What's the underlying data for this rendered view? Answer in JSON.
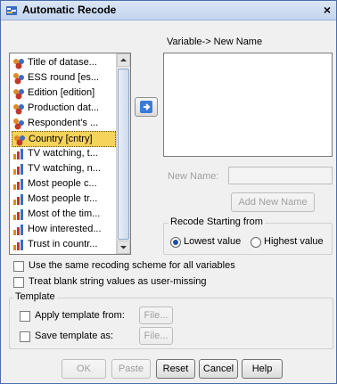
{
  "window": {
    "title": "Automatic Recode",
    "close_glyph": "×"
  },
  "left_list": {
    "items": [
      {
        "label": "Title of datase...",
        "icon": "nominal-icon",
        "selected": false
      },
      {
        "label": "ESS round [es...",
        "icon": "ordinal-icon",
        "selected": false
      },
      {
        "label": "Edition [edition]",
        "icon": "nominal-icon",
        "selected": false
      },
      {
        "label": "Production dat...",
        "icon": "nominal-icon",
        "selected": false
      },
      {
        "label": "Respondent's ...",
        "icon": "ordinal-icon",
        "selected": false
      },
      {
        "label": "Country [cntry]",
        "icon": "nominal-icon",
        "selected": true
      },
      {
        "label": "TV watching, t...",
        "icon": "scale-icon",
        "selected": false
      },
      {
        "label": "TV watching, n...",
        "icon": "scale-icon",
        "selected": false
      },
      {
        "label": "Most people c...",
        "icon": "scale-icon",
        "selected": false
      },
      {
        "label": "Most people tr...",
        "icon": "scale-icon",
        "selected": false
      },
      {
        "label": "Most of the tim...",
        "icon": "scale-icon",
        "selected": false
      },
      {
        "label": "How interested...",
        "icon": "scale-icon",
        "selected": false
      },
      {
        "label": "Trust in countr...",
        "icon": "scale-icon",
        "selected": false
      }
    ]
  },
  "right_panel": {
    "header": "Variable-> New Name",
    "new_name_label": "New Name:",
    "new_name_value": "",
    "add_button": "Add New Name"
  },
  "recode_group": {
    "title": "Recode Starting from",
    "lowest_label": "Lowest value",
    "highest_label": "Highest value",
    "selected": "lowest"
  },
  "options": {
    "same_scheme": "Use the same recoding scheme for all variables",
    "treat_blank": "Treat blank string values as user-missing"
  },
  "template": {
    "title": "Template",
    "apply_label": "Apply template from:",
    "save_label": "Save template as:",
    "file_button": "File..."
  },
  "buttons": {
    "ok": "OK",
    "paste": "Paste",
    "reset": "Reset",
    "cancel": "Cancel",
    "help": "Help"
  },
  "colors": {
    "selected_row": "#f6d35b",
    "arrow_blue": "#3d7bd6",
    "nominal_red": "#c0392b",
    "scale_orange": "#e08a1e"
  }
}
